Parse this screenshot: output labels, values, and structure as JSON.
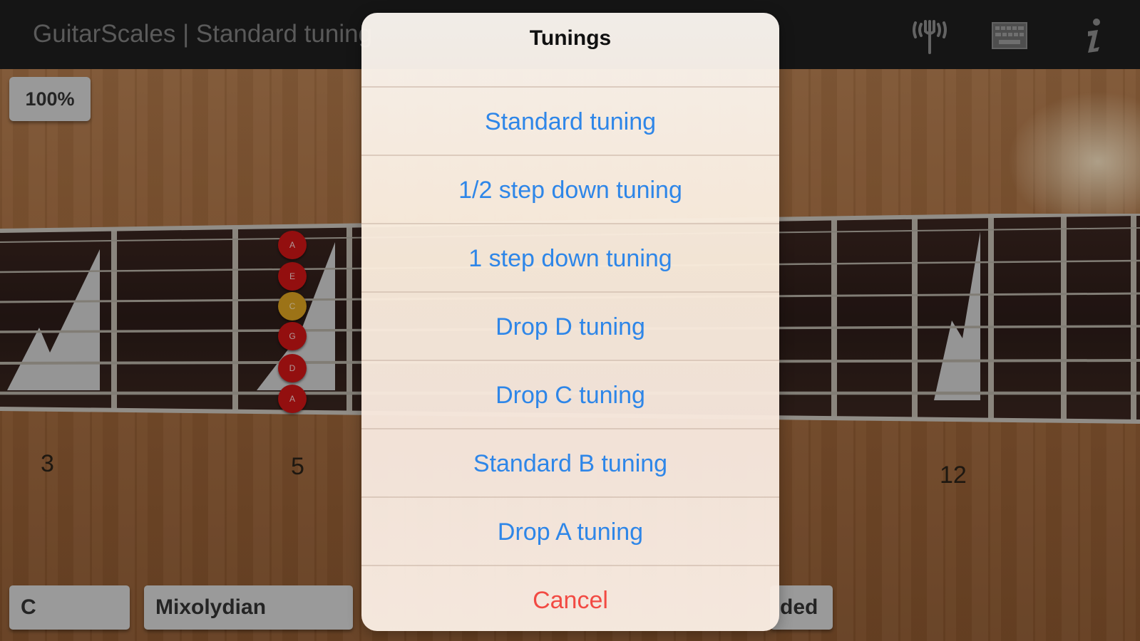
{
  "app": {
    "title": "GuitarScales | Standard tuning"
  },
  "toolbar": {
    "icons": [
      "tuner-icon",
      "keyboard-icon",
      "info-icon"
    ]
  },
  "zoom": {
    "label": "100%"
  },
  "fretboard": {
    "fret_numbers": [
      "3",
      "5",
      "12"
    ],
    "notes": [
      "A",
      "E",
      "C",
      "G",
      "D",
      "A"
    ],
    "root_color": "#d8a020",
    "note_color": "#cc1515"
  },
  "bottom_bar": {
    "key_label": "C",
    "scale_label": "Mixolydian",
    "right_label_partial": "ded"
  },
  "tunings_sheet": {
    "title": "Tunings",
    "items": [
      "Standard tuning",
      "1/2 step down tuning",
      "1 step down tuning",
      "Drop D tuning",
      "Drop C tuning",
      "Standard B tuning",
      "Drop A tuning"
    ],
    "cancel_label": "Cancel",
    "accent_color": "#2e86e8",
    "cancel_color": "#f24a43"
  }
}
